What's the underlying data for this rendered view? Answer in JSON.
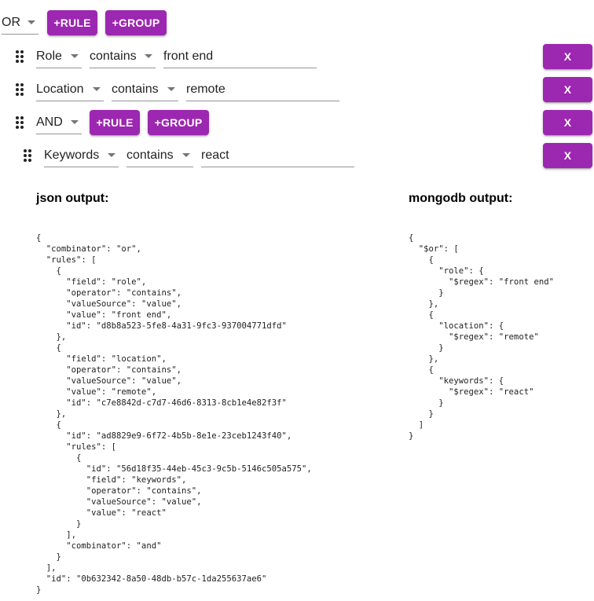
{
  "root_group": {
    "combinator": "OR",
    "add_rule_label": "+RULE",
    "add_group_label": "+GROUP"
  },
  "rules": [
    {
      "field": "Role",
      "operator": "contains",
      "value": "front end",
      "remove_label": "X"
    },
    {
      "field": "Location",
      "operator": "contains",
      "value": "remote",
      "remove_label": "X"
    }
  ],
  "sub_group": {
    "combinator": "AND",
    "add_rule_label": "+RULE",
    "add_group_label": "+GROUP",
    "remove_label": "X",
    "rules": [
      {
        "field": "Keywords",
        "operator": "contains",
        "value": "react",
        "remove_label": "X"
      }
    ]
  },
  "outputs": {
    "json_heading": "json output:",
    "mongodb_heading": "mongodb output:",
    "json_text": "{\n  \"combinator\": \"or\",\n  \"rules\": [\n    {\n      \"field\": \"role\",\n      \"operator\": \"contains\",\n      \"valueSource\": \"value\",\n      \"value\": \"front end\",\n      \"id\": \"d8b8a523-5fe8-4a31-9fc3-937004771dfd\"\n    },\n    {\n      \"field\": \"location\",\n      \"operator\": \"contains\",\n      \"valueSource\": \"value\",\n      \"value\": \"remote\",\n      \"id\": \"c7e8842d-c7d7-46d6-8313-8cb1e4e82f3f\"\n    },\n    {\n      \"id\": \"ad8829e9-6f72-4b5b-8e1e-23ceb1243f40\",\n      \"rules\": [\n        {\n          \"id\": \"56d18f35-44eb-45c3-9c5b-5146c505a575\",\n          \"field\": \"keywords\",\n          \"operator\": \"contains\",\n          \"valueSource\": \"value\",\n          \"value\": \"react\"\n        }\n      ],\n      \"combinator\": \"and\"\n    }\n  ],\n  \"id\": \"0b632342-8a50-48db-b57c-1da255637ae6\"\n}",
    "mongodb_text": "{\n  \"$or\": [\n    {\n      \"role\": {\n        \"$regex\": \"front end\"\n      }\n    },\n    {\n      \"location\": {\n        \"$regex\": \"remote\"\n      }\n    },\n    {\n      \"keywords\": {\n        \"$regex\": \"react\"\n      }\n    }\n  ]\n}"
  }
}
